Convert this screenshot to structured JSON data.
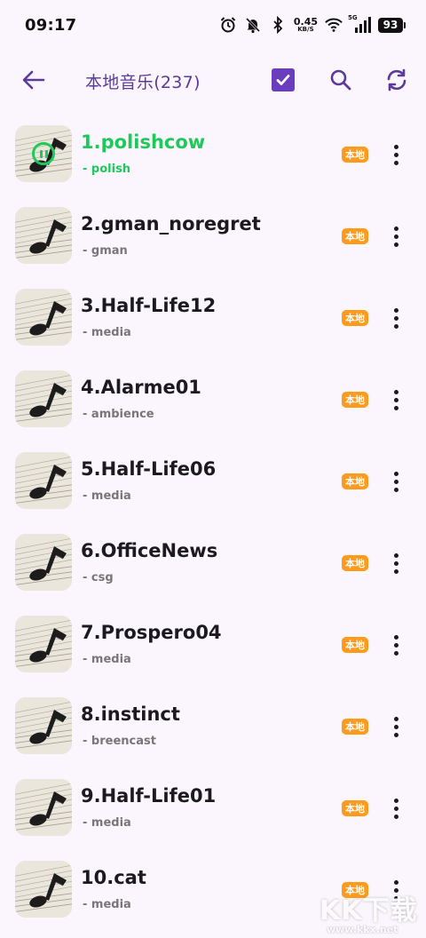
{
  "status_bar": {
    "time": "09:17",
    "net_speed_value": "0.45",
    "net_speed_unit": "KB/S",
    "network_type": "5G",
    "battery": "93",
    "icons": [
      "alarm-icon",
      "mute-bell-icon",
      "bluetooth-icon",
      "wifi-icon",
      "signal-icon",
      "battery-icon"
    ]
  },
  "toolbar": {
    "title": "本地音乐(237)",
    "icons": [
      "back-arrow-icon",
      "select-all-checkbox-icon",
      "search-icon",
      "refresh-icon"
    ],
    "accent_color": "#6a3dbf"
  },
  "songs": [
    {
      "title": "1.polishcow",
      "artist": "- polish",
      "badge": "本地",
      "playing": true
    },
    {
      "title": "2.gman_noregret",
      "artist": "- gman",
      "badge": "本地",
      "playing": false
    },
    {
      "title": "3.Half-Life12",
      "artist": "- media",
      "badge": "本地",
      "playing": false
    },
    {
      "title": "4.Alarme01",
      "artist": "- ambience",
      "badge": "本地",
      "playing": false
    },
    {
      "title": "5.Half-Life06",
      "artist": "- media",
      "badge": "本地",
      "playing": false
    },
    {
      "title": "6.OfficeNews",
      "artist": "- csg",
      "badge": "本地",
      "playing": false
    },
    {
      "title": "7.Prospero04",
      "artist": "- media",
      "badge": "本地",
      "playing": false
    },
    {
      "title": "8.instinct",
      "artist": "- breencast",
      "badge": "本地",
      "playing": false
    },
    {
      "title": "9.Half-Life01",
      "artist": "- media",
      "badge": "本地",
      "playing": false
    },
    {
      "title": "10.cat",
      "artist": "- media",
      "badge": "本地",
      "playing": false
    }
  ],
  "colors": {
    "playing": "#1ec95a",
    "badge": "#ff9a1a",
    "background": "#fbf6fd"
  },
  "watermark": {
    "main": "KK下载",
    "sub": "www.kkx.net"
  }
}
